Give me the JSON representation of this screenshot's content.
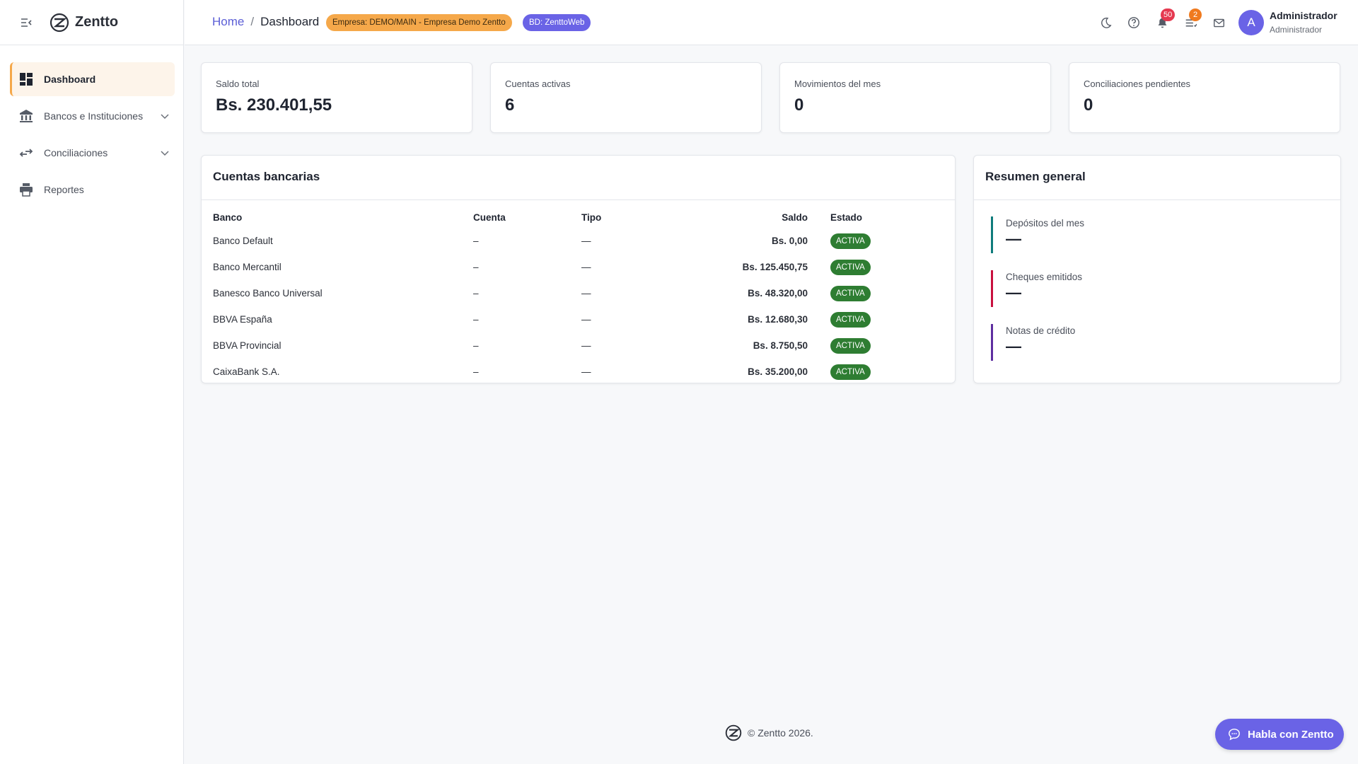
{
  "app": {
    "name": "Zentto"
  },
  "sidebar": {
    "items": [
      {
        "label": "Dashboard",
        "icon": "dashboard-icon",
        "active": true
      },
      {
        "label": "Bancos e Instituciones",
        "icon": "bank-icon",
        "expandable": true
      },
      {
        "label": "Conciliaciones",
        "icon": "compare-arrows-icon",
        "expandable": true
      },
      {
        "label": "Reportes",
        "icon": "print-icon"
      }
    ]
  },
  "header": {
    "breadcrumb": {
      "home": "Home",
      "separator": "/",
      "current": "Dashboard"
    },
    "empresa_pill": "Empresa: DEMO/MAIN - Empresa Demo Zentto",
    "bd_pill": "BD: ZenttoWeb",
    "notifications_count": "50",
    "tasks_count": "2",
    "user": {
      "initial": "A",
      "name": "Administrador",
      "role": "Administrador"
    }
  },
  "stats": [
    {
      "label": "Saldo total",
      "value": "Bs. 230.401,55"
    },
    {
      "label": "Cuentas activas",
      "value": "6"
    },
    {
      "label": "Movimientos del mes",
      "value": "0"
    },
    {
      "label": "Conciliaciones pendientes",
      "value": "0"
    }
  ],
  "accounts": {
    "title": "Cuentas bancarias",
    "columns": [
      "Banco",
      "Cuenta",
      "Tipo",
      "Saldo",
      "Estado"
    ],
    "rows": [
      {
        "banco": "Banco Default",
        "cuenta": "–",
        "tipo": "—",
        "saldo": "Bs. 0,00",
        "estado": "ACTIVA"
      },
      {
        "banco": "Banco Mercantil",
        "cuenta": "–",
        "tipo": "—",
        "saldo": "Bs. 125.450,75",
        "estado": "ACTIVA"
      },
      {
        "banco": "Banesco Banco Universal",
        "cuenta": "–",
        "tipo": "—",
        "saldo": "Bs. 48.320,00",
        "estado": "ACTIVA"
      },
      {
        "banco": "BBVA España",
        "cuenta": "–",
        "tipo": "—",
        "saldo": "Bs. 12.680,30",
        "estado": "ACTIVA"
      },
      {
        "banco": "BBVA Provincial",
        "cuenta": "–",
        "tipo": "—",
        "saldo": "Bs. 8.750,50",
        "estado": "ACTIVA"
      },
      {
        "banco": "CaixaBank S.A.",
        "cuenta": "–",
        "tipo": "—",
        "saldo": "Bs. 35.200,00",
        "estado": "ACTIVA"
      }
    ]
  },
  "summary": {
    "title": "Resumen general",
    "items": [
      {
        "label": "Depósitos del mes",
        "value": "—",
        "color": "#0f7c7c"
      },
      {
        "label": "Cheques emitidos",
        "value": "—",
        "color": "#c8103e"
      },
      {
        "label": "Notas de crédito",
        "value": "—",
        "color": "#5e2ea0"
      }
    ]
  },
  "footer": {
    "text": "© Zentto 2026."
  },
  "chat": {
    "label": "Habla con Zentto"
  },
  "colors": {
    "accent": "#6a63e6",
    "warning": "#f5a84a",
    "success": "#2e7d32",
    "danger": "#e53950"
  }
}
